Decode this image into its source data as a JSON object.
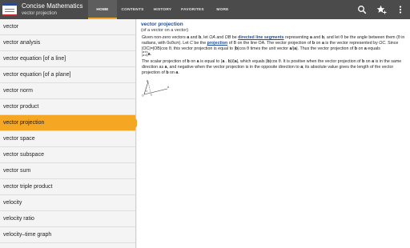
{
  "app": {
    "title": "Concise Mathematics",
    "subtitle": "vector projection",
    "icon": "oxford-dictionary-icon"
  },
  "tabs": [
    {
      "label": "HOME",
      "active": true
    },
    {
      "label": "CONTENTS",
      "active": false
    },
    {
      "label": "HISTORY",
      "active": false
    },
    {
      "label": "FAVORITES",
      "active": false
    },
    {
      "label": "MORE",
      "active": false
    }
  ],
  "actions": [
    {
      "icon": "search-icon"
    },
    {
      "icon": "star-add-icon"
    },
    {
      "icon": "overflow-menu-icon"
    }
  ],
  "sidebar": {
    "items": [
      {
        "label": "vector"
      },
      {
        "label": "vector analysis"
      },
      {
        "label": "vector equation [of a line]"
      },
      {
        "label": "vector equation [of a plane]"
      },
      {
        "label": "vector norm"
      },
      {
        "label": "vector product"
      },
      {
        "label": "vector projection",
        "selected": true
      },
      {
        "label": "vector space"
      },
      {
        "label": "vector subspace"
      },
      {
        "label": "vector sum"
      },
      {
        "label": "vector triple product"
      },
      {
        "label": "velocity"
      },
      {
        "label": "velocity ratio"
      },
      {
        "label": "velocity–time graph"
      }
    ]
  },
  "entry": {
    "title": "vector projection",
    "subtitle": "(of a vector on a vector)",
    "p1": {
      "t1": "Given non-zero vectors ",
      "a": "a",
      "t2": " and ",
      "b": "b",
      "t3": ", let ",
      "oa": "OA",
      "t4": " and ",
      "ob": "OB",
      "t5": " be ",
      "link1": "directed line segments",
      "t6": " representing ",
      "a2": "a",
      "t7": " and ",
      "b2": "b",
      "t8": ", and let θ be the angle between them (θ in radians, with 0≤θ≤π). Let ",
      "c": "C",
      "t9": " be the ",
      "link2": "projection",
      "t10": " of B on the line OA. The vector projection of ",
      "b3": "b",
      "t11": " on ",
      "a3": "a",
      "t12": " is the vector represented by ",
      "oc": "OC",
      "t13": ". Since |OC|=|OB|cos θ, this vector projection is equal to |",
      "b4": "b",
      "t14": "|cos θ times the unit vector ",
      "a4": "a",
      "t15": "/|",
      "a5": "a",
      "t16": "|. Thus the vector projection of ",
      "b5": "b",
      "t17": " on ",
      "a6": "a",
      "t18": " equals",
      "frac_top": "(a·b)",
      "frac_bot": "(a·a)",
      "frac_tail": "a",
      "t19": "."
    },
    "p2": {
      "t1": "The scalar projection of ",
      "b": "b",
      "t2": " on ",
      "a": "a",
      "t3": " is equal to (",
      "a2": "a",
      "t4": " . ",
      "b2": "b",
      "t5": ")/|",
      "a3": "a",
      "t6": "|, which equals |",
      "b3": "b",
      "t7": "|cos θ. It is positive when the vector projection of ",
      "b4": "b",
      "t8": " on ",
      "a4": "a",
      "t9": " is in the same direction as ",
      "a5": "a",
      "t10": ", and negative when the vector projection is in the opposite direction to ",
      "a6": "a",
      "t11": "; its absolute value gives the length of the vector projection of ",
      "b5": "b",
      "t12": " on ",
      "a7": "a",
      "t13": "."
    },
    "figure": {
      "labels": [
        "B",
        "A",
        "O",
        "C",
        "θ"
      ]
    }
  },
  "colors": {
    "actionbar": "#4b4b4b",
    "accent": "#f5a623",
    "link": "#1f4ea0"
  }
}
